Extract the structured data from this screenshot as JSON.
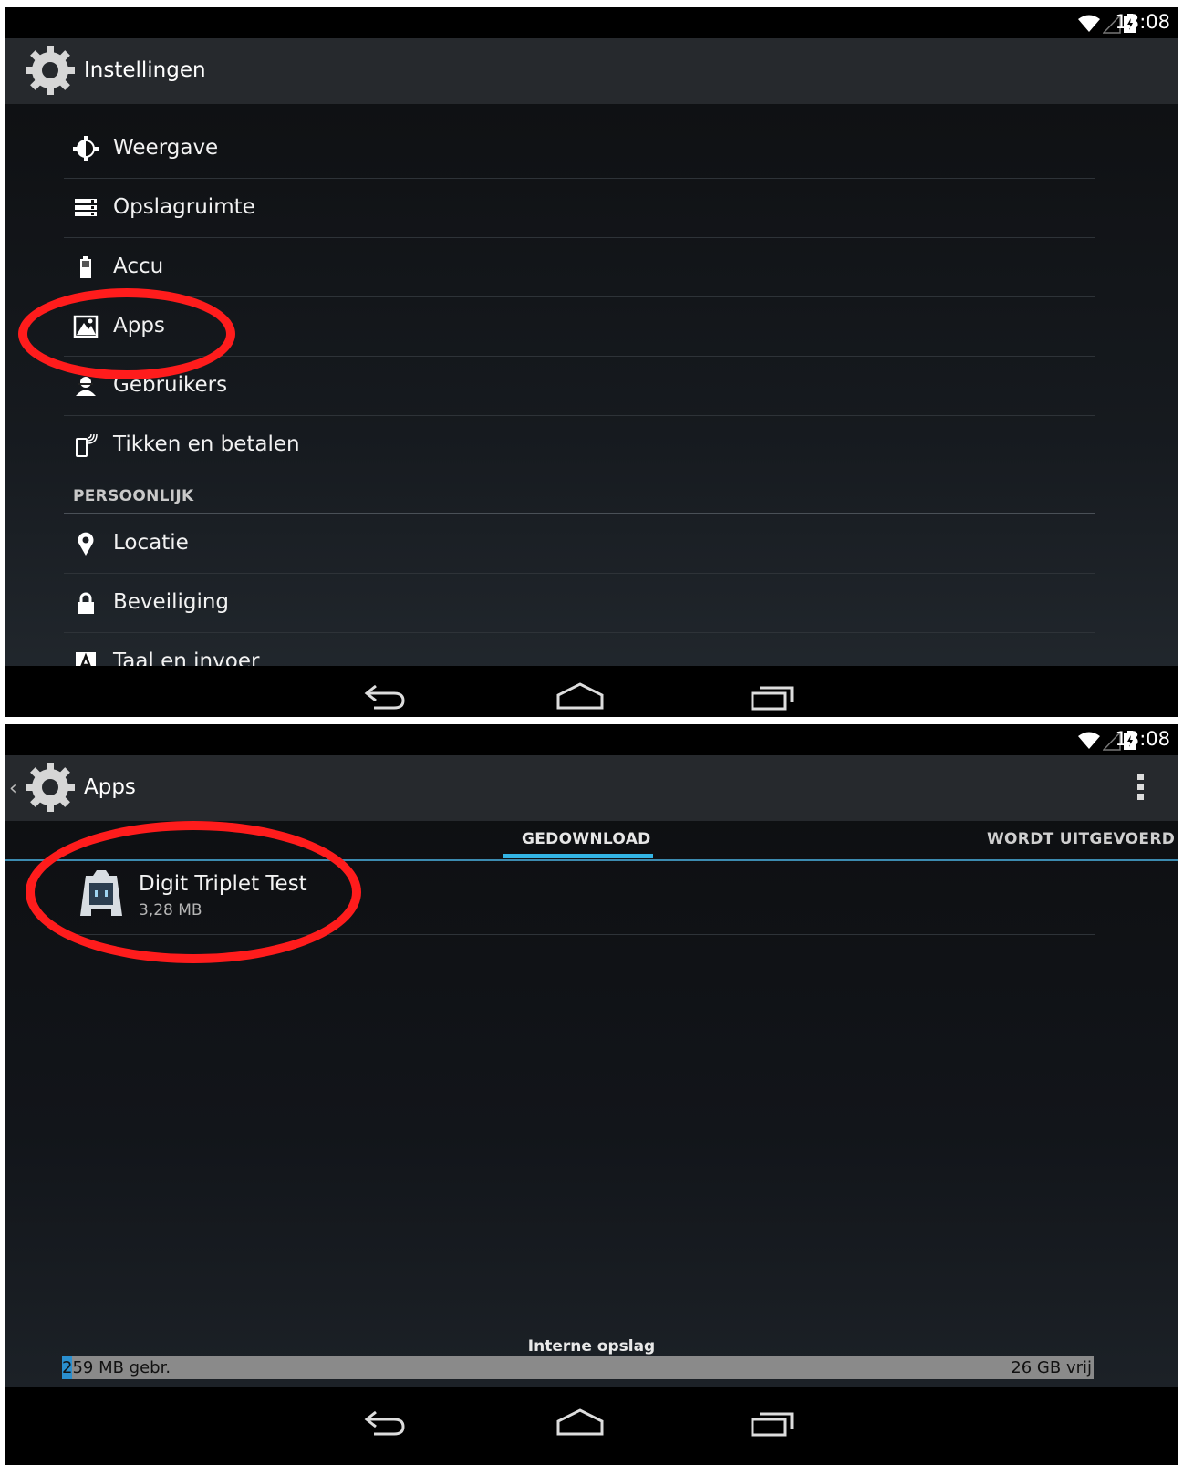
{
  "status_bar": {
    "time": "13:08"
  },
  "settings_screen": {
    "title": "Instellingen",
    "items": [
      {
        "label": "Weergave",
        "icon": "display-icon"
      },
      {
        "label": "Opslagruimte",
        "icon": "storage-icon"
      },
      {
        "label": "Accu",
        "icon": "battery-icon"
      },
      {
        "label": "Apps",
        "icon": "apps-icon"
      },
      {
        "label": "Gebruikers",
        "icon": "users-icon"
      },
      {
        "label": "Tikken en betalen",
        "icon": "nfc-icon"
      }
    ],
    "section_header": "PERSOONLIJK",
    "personal_items": [
      {
        "label": "Locatie",
        "icon": "location-icon"
      },
      {
        "label": "Beveiliging",
        "icon": "lock-icon"
      },
      {
        "label": "Taal en invoer",
        "icon": "language-icon"
      }
    ]
  },
  "apps_screen": {
    "title": "Apps",
    "tabs": [
      "GEDOWNLOAD",
      "WORDT UITGEVOERD"
    ],
    "selected_tab": "GEDOWNLOAD",
    "apps": [
      {
        "name": "Digit Triplet Test",
        "size": "3,28 MB",
        "icon": "cordova-app-icon"
      }
    ],
    "storage": {
      "label": "Interne opslag",
      "used": "259 MB gebr.",
      "free": "26 GB vrij",
      "used_fraction": 0.01
    }
  },
  "annotation_color": "#ff1c1c",
  "accent_color": "#33b5e5"
}
